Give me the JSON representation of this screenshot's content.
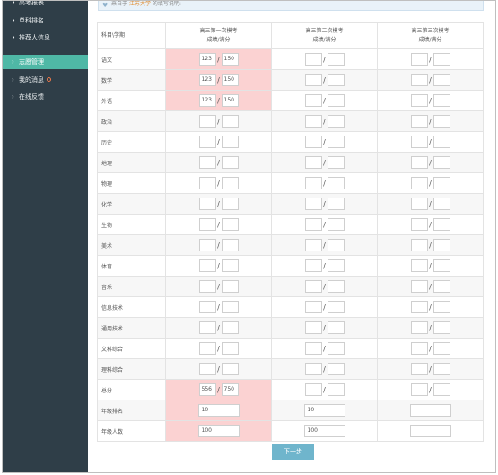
{
  "sidebar": {
    "items": [
      {
        "label": "高考报表",
        "prefix": "•"
      },
      {
        "label": "单科排名",
        "prefix": "•"
      },
      {
        "label": "推荐人信息",
        "prefix": "•"
      },
      {
        "label": "志愿管理",
        "prefix": "›"
      },
      {
        "label": "我的消息",
        "prefix": "›"
      },
      {
        "label": "在线反馈",
        "prefix": "›"
      }
    ],
    "active_index": 3
  },
  "notice": {
    "prefix": "来自于",
    "highlight": "江苏大学",
    "suffix": "的填写说明:"
  },
  "table": {
    "subject_header": "科目\\学期",
    "columns": [
      {
        "title": "高三第一次模考",
        "sub": "成绩/满分"
      },
      {
        "title": "高三第二次模考",
        "sub": "成绩/满分"
      },
      {
        "title": "高三第三次模考",
        "sub": "成绩/满分"
      }
    ],
    "rows": [
      {
        "subject": "语文",
        "scores": [
          {
            "score": "123",
            "full": "150"
          },
          {
            "score": "",
            "full": ""
          },
          {
            "score": "",
            "full": ""
          }
        ]
      },
      {
        "subject": "数学",
        "scores": [
          {
            "score": "123",
            "full": "150"
          },
          {
            "score": "",
            "full": ""
          },
          {
            "score": "",
            "full": ""
          }
        ]
      },
      {
        "subject": "外语",
        "scores": [
          {
            "score": "123",
            "full": "150"
          },
          {
            "score": "",
            "full": ""
          },
          {
            "score": "",
            "full": ""
          }
        ]
      },
      {
        "subject": "政治",
        "scores": [
          {
            "score": "",
            "full": ""
          },
          {
            "score": "",
            "full": ""
          },
          {
            "score": "",
            "full": ""
          }
        ]
      },
      {
        "subject": "历史",
        "scores": [
          {
            "score": "",
            "full": ""
          },
          {
            "score": "",
            "full": ""
          },
          {
            "score": "",
            "full": ""
          }
        ]
      },
      {
        "subject": "地理",
        "scores": [
          {
            "score": "",
            "full": ""
          },
          {
            "score": "",
            "full": ""
          },
          {
            "score": "",
            "full": ""
          }
        ]
      },
      {
        "subject": "物理",
        "scores": [
          {
            "score": "",
            "full": ""
          },
          {
            "score": "",
            "full": ""
          },
          {
            "score": "",
            "full": ""
          }
        ]
      },
      {
        "subject": "化学",
        "scores": [
          {
            "score": "",
            "full": ""
          },
          {
            "score": "",
            "full": ""
          },
          {
            "score": "",
            "full": ""
          }
        ]
      },
      {
        "subject": "生物",
        "scores": [
          {
            "score": "",
            "full": ""
          },
          {
            "score": "",
            "full": ""
          },
          {
            "score": "",
            "full": ""
          }
        ]
      },
      {
        "subject": "美术",
        "scores": [
          {
            "score": "",
            "full": ""
          },
          {
            "score": "",
            "full": ""
          },
          {
            "score": "",
            "full": ""
          }
        ]
      },
      {
        "subject": "体育",
        "scores": [
          {
            "score": "",
            "full": ""
          },
          {
            "score": "",
            "full": ""
          },
          {
            "score": "",
            "full": ""
          }
        ]
      },
      {
        "subject": "音乐",
        "scores": [
          {
            "score": "",
            "full": ""
          },
          {
            "score": "",
            "full": ""
          },
          {
            "score": "",
            "full": ""
          }
        ]
      },
      {
        "subject": "信息技术",
        "scores": [
          {
            "score": "",
            "full": ""
          },
          {
            "score": "",
            "full": ""
          },
          {
            "score": "",
            "full": ""
          }
        ]
      },
      {
        "subject": "通用技术",
        "scores": [
          {
            "score": "",
            "full": ""
          },
          {
            "score": "",
            "full": ""
          },
          {
            "score": "",
            "full": ""
          }
        ]
      },
      {
        "subject": "文科综合",
        "scores": [
          {
            "score": "",
            "full": ""
          },
          {
            "score": "",
            "full": ""
          },
          {
            "score": "",
            "full": ""
          }
        ]
      },
      {
        "subject": "理科综合",
        "scores": [
          {
            "score": "",
            "full": ""
          },
          {
            "score": "",
            "full": ""
          },
          {
            "score": "",
            "full": ""
          }
        ]
      },
      {
        "subject": "总分",
        "scores": [
          {
            "score": "556",
            "full": "750"
          },
          {
            "score": "",
            "full": ""
          },
          {
            "score": "",
            "full": ""
          }
        ]
      }
    ],
    "grade_rank": {
      "label": "年级排名",
      "values": [
        "10",
        "10",
        ""
      ]
    },
    "grade_count": {
      "label": "年级人数",
      "values": [
        "100",
        "100",
        ""
      ]
    }
  },
  "next_button": "下一步",
  "colors": {
    "sidebar": "#2f3e48",
    "active": "#4fb8a6",
    "highlight_cell": "#fbd2d2",
    "button": "#6fb5cc"
  }
}
